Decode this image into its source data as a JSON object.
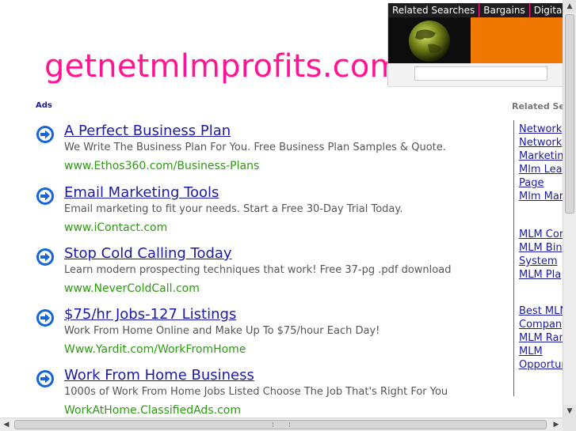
{
  "site": {
    "title": "getnetmlmprofits.com"
  },
  "widget": {
    "tabs": [
      "Related Searches",
      "Bargains",
      "Digital C"
    ],
    "search_placeholder": "",
    "colors": {
      "tab_bg": "#1e1e1e",
      "tab_separator": "#ff1493",
      "banner": "#f07800"
    }
  },
  "ads": {
    "label": "Ads",
    "items": [
      {
        "title": "A Perfect Business Plan",
        "desc": "We Write The Business Plan For You. Free Business Plan Samples & Quote.",
        "url": "www.Ethos360.com/Business-Plans"
      },
      {
        "title": "Email Marketing Tools",
        "desc": "Email marketing to fit your needs. Start a Free 30-Day Trial Today.",
        "url": "www.iContact.com"
      },
      {
        "title": "Stop Cold Calling Today",
        "desc": "Learn modern prospecting techniques that work! Free 37-pg .pdf download",
        "url": "www.NeverColdCall.com"
      },
      {
        "title": "$75/hr Jobs-127 Listings",
        "desc": "Work From Home Online and Make Up To $75/hour Each Day!",
        "url": "Www.Yardit.com/WorkFromHome"
      },
      {
        "title": "Work From Home Business",
        "desc": "1000s of Work From Home Jobs Listed Choose The Job That's Right For You",
        "url": "WorkAtHome.ClassifiedAds.com"
      }
    ]
  },
  "related": {
    "heading": "Related Sea",
    "links": [
      "Network",
      "Network",
      "Marketin",
      "Mlm Lea",
      "Page",
      "Mlm Mar",
      "MLM Cor",
      "MLM Bin",
      "System",
      "MLM Pla",
      "Best MLN",
      "Company",
      "MLM Ran",
      "MLM",
      "Opportun"
    ]
  },
  "colors": {
    "title_pink": "#ff1493",
    "link_blue": "#1a1aa6",
    "url_green": "#2b9a0f",
    "arrow_blue": "#1565d8"
  },
  "icons": {
    "ad_arrow": "arrow-right-circle-icon",
    "scroll_up": "scroll-up-arrow-icon",
    "scroll_down": "scroll-down-arrow-icon",
    "scroll_left": "scroll-left-arrow-icon",
    "scroll_right": "scroll-right-arrow-icon"
  }
}
